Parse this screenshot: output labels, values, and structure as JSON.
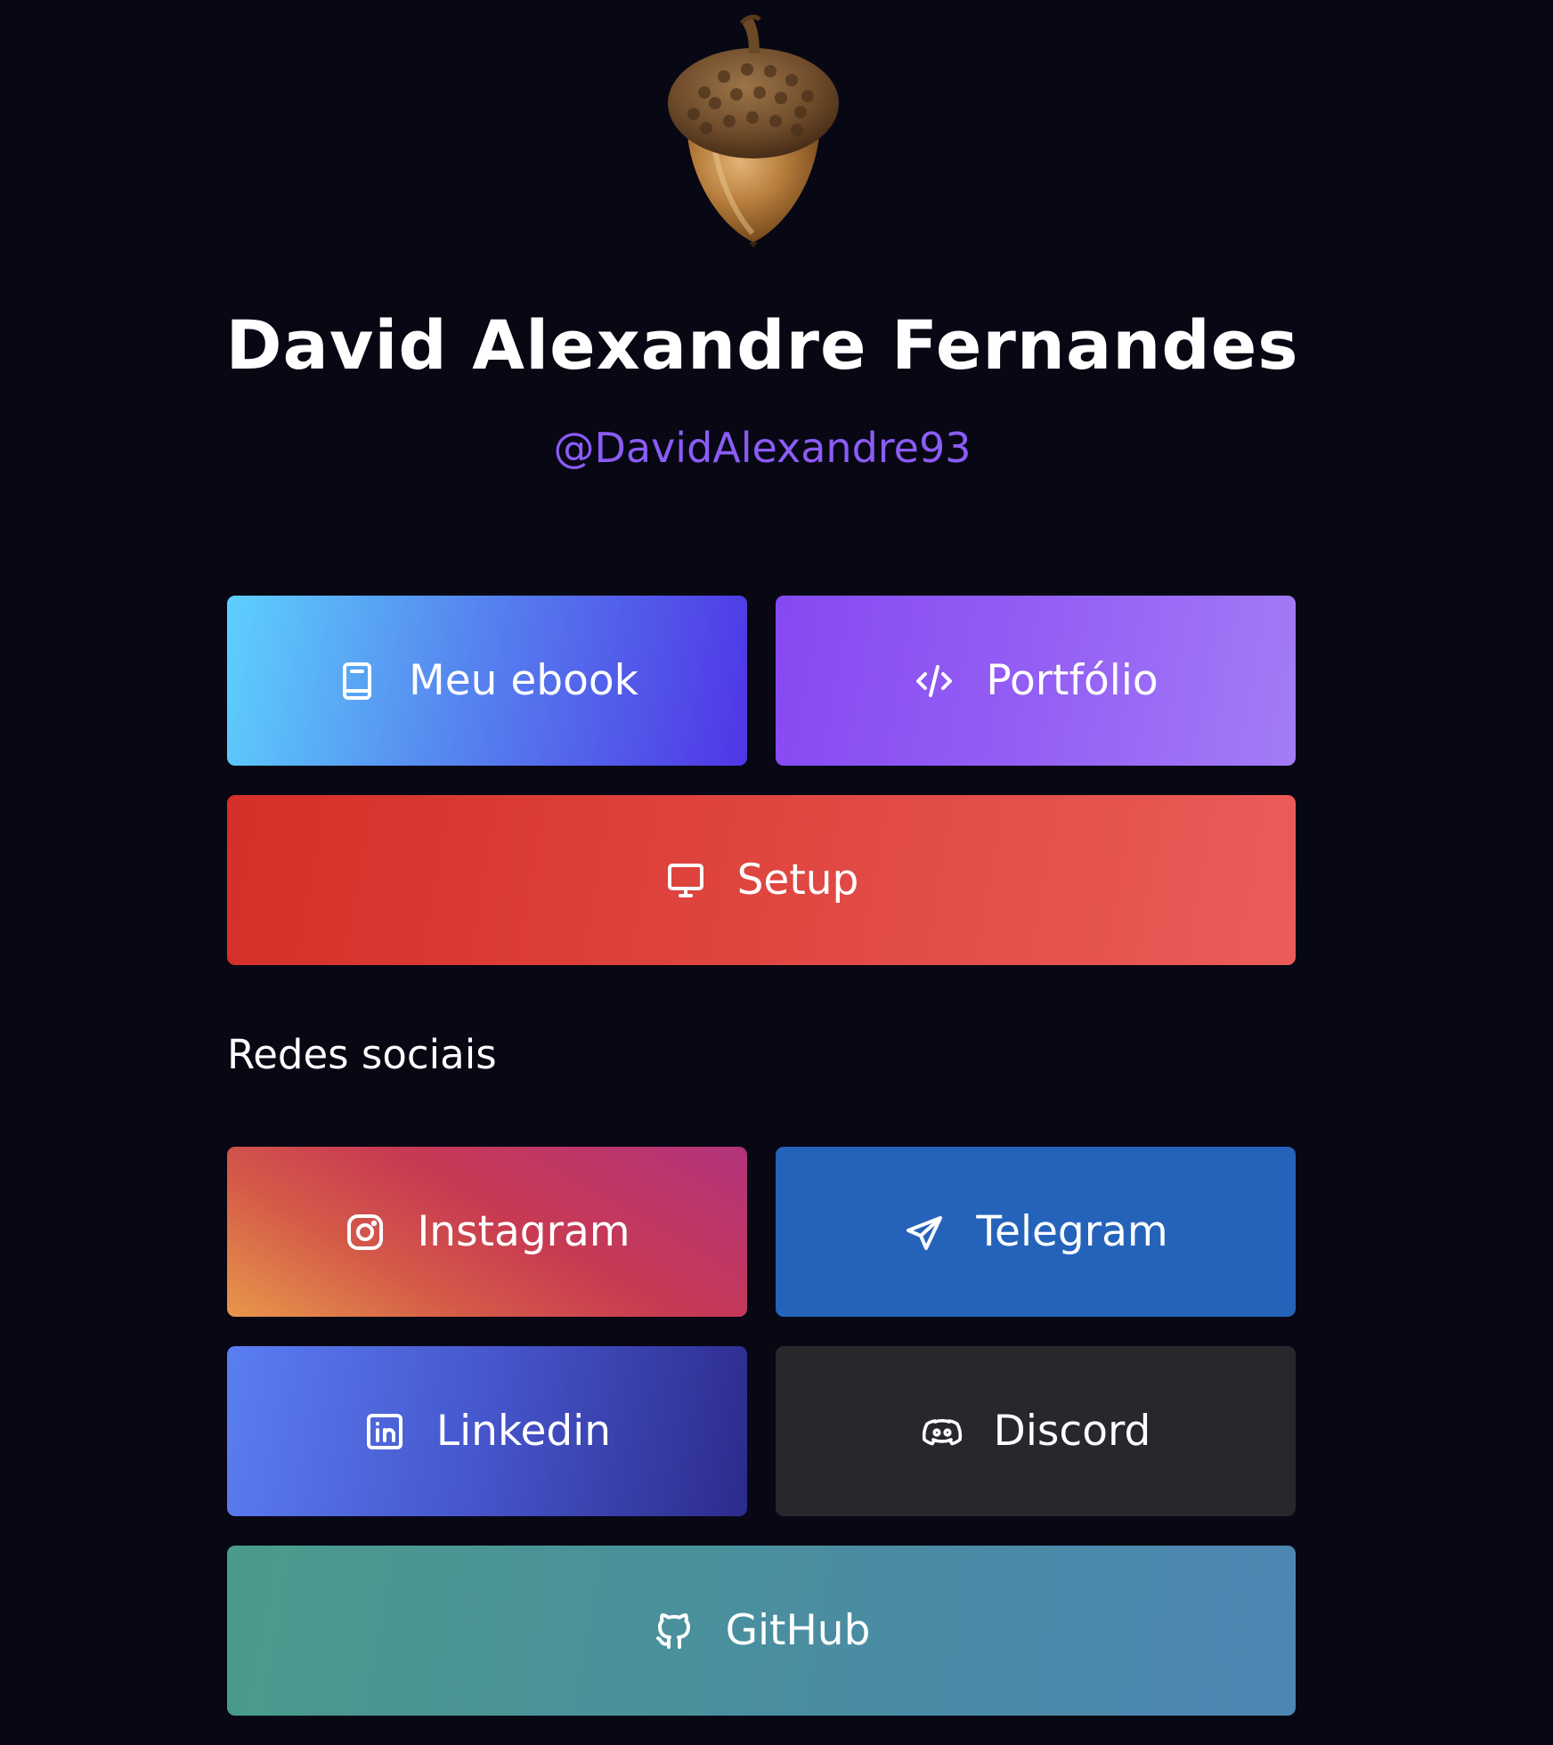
{
  "profile": {
    "name": "David Alexandre Fernandes",
    "handle": "@DavidAlexandre93",
    "avatar_icon": "acorn-avatar"
  },
  "links": {
    "ebook": {
      "label": "Meu ebook",
      "icon": "book-icon"
    },
    "portfolio": {
      "label": "Portfólio",
      "icon": "code-icon"
    },
    "setup": {
      "label": "Setup",
      "icon": "monitor-icon"
    }
  },
  "social": {
    "title": "Redes sociais",
    "instagram": {
      "label": "Instagram",
      "icon": "instagram-icon"
    },
    "telegram": {
      "label": "Telegram",
      "icon": "telegram-icon"
    },
    "linkedin": {
      "label": "Linkedin",
      "icon": "linkedin-icon"
    },
    "discord": {
      "label": "Discord",
      "icon": "discord-icon"
    },
    "github": {
      "label": "GitHub",
      "icon": "github-icon"
    }
  },
  "colors": {
    "background": "#080714",
    "handle": "#8b5cf6",
    "telegram": "#2563bb",
    "discord": "#27282c"
  }
}
